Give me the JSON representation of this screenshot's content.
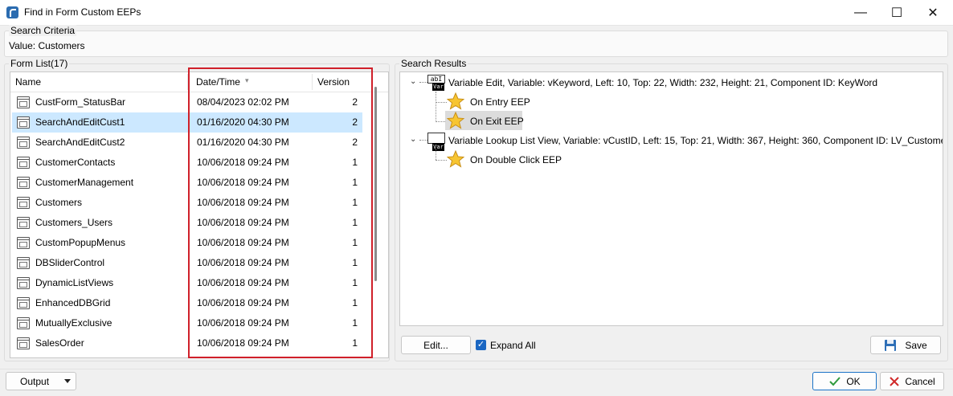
{
  "window": {
    "title": "Find in Form Custom EEPs",
    "minimize_glyph": "—",
    "maximize_glyph": "☐",
    "close_glyph": "✕"
  },
  "search_criteria": {
    "legend": "Search Criteria",
    "value_text": "Value: Customers"
  },
  "form_list": {
    "legend": "Form List(17)",
    "columns": {
      "name": "Name",
      "date": "Date/Time",
      "version": "Version"
    },
    "sort_indicator": "▾",
    "rows": [
      {
        "name": "CustForm_StatusBar",
        "date": "08/04/2023 02:02 PM",
        "version": "2"
      },
      {
        "name": "SearchAndEditCust1",
        "date": "01/16/2020 04:30 PM",
        "version": "2",
        "selected": true
      },
      {
        "name": "SearchAndEditCust2",
        "date": "01/16/2020 04:30 PM",
        "version": "2"
      },
      {
        "name": "CustomerContacts",
        "date": "10/06/2018 09:24 PM",
        "version": "1"
      },
      {
        "name": "CustomerManagement",
        "date": "10/06/2018 09:24 PM",
        "version": "1"
      },
      {
        "name": "Customers",
        "date": "10/06/2018 09:24 PM",
        "version": "1"
      },
      {
        "name": "Customers_Users",
        "date": "10/06/2018 09:24 PM",
        "version": "1"
      },
      {
        "name": "CustomPopupMenus",
        "date": "10/06/2018 09:24 PM",
        "version": "1"
      },
      {
        "name": "DBSliderControl",
        "date": "10/06/2018 09:24 PM",
        "version": "1"
      },
      {
        "name": "DynamicListViews",
        "date": "10/06/2018 09:24 PM",
        "version": "1"
      },
      {
        "name": "EnhancedDBGrid",
        "date": "10/06/2018 09:24 PM",
        "version": "1"
      },
      {
        "name": "MutuallyExclusive",
        "date": "10/06/2018 09:24 PM",
        "version": "1"
      },
      {
        "name": "SalesOrder",
        "date": "10/06/2018 09:24 PM",
        "version": "1"
      }
    ]
  },
  "search_results": {
    "legend": "Search Results",
    "nodes": [
      {
        "label": "Variable Edit, Variable: vKeyword, Left: 10, Top: 22, Width: 232, Height: 21, Component ID: KeyWord",
        "icon_top": "abI",
        "icon_bottom": "Var",
        "children": [
          {
            "label": "On Entry EEP"
          },
          {
            "label": "On Exit EEP",
            "selected": true
          }
        ]
      },
      {
        "label": "Variable Lookup List View, Variable: vCustID, Left: 15, Top: 21, Width: 367, Height: 360, Component ID: LV_Customers",
        "icon_top": "",
        "icon_bottom": "Var",
        "children": [
          {
            "label": "On Double Click EEP"
          }
        ]
      }
    ]
  },
  "actions": {
    "edit_label": "Edit...",
    "expand_all_label": "Expand All",
    "expand_all_checked": true,
    "save_label": "Save"
  },
  "footer": {
    "output_label": "Output",
    "ok_label": "OK",
    "cancel_label": "Cancel"
  },
  "colors": {
    "selection": "#cce8ff",
    "highlight_border": "#d0202a",
    "accent": "#1a66c2"
  }
}
